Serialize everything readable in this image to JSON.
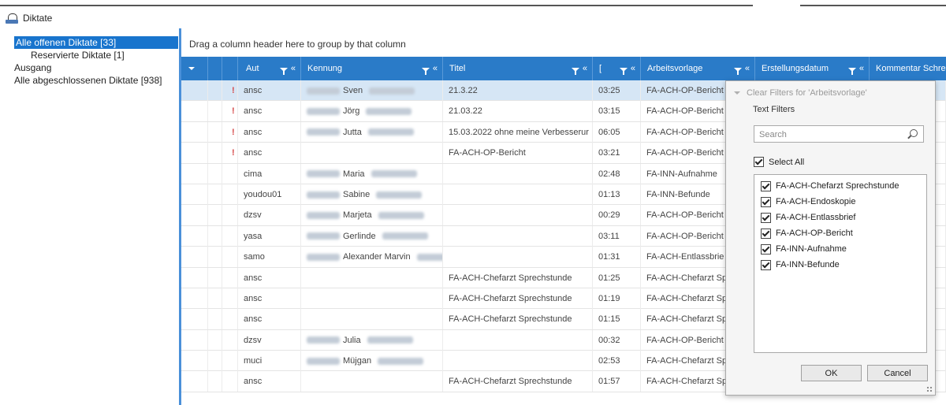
{
  "app": {
    "title": "Diktate"
  },
  "tree": {
    "items": [
      {
        "label": "Alle offenen Diktate  [33]",
        "selected": true,
        "indent": false
      },
      {
        "label": "Reservierte Diktate  [1]",
        "selected": false,
        "indent": true
      },
      {
        "label": "Ausgang",
        "selected": false,
        "indent": false
      },
      {
        "label": "Alle abgeschlossenen Diktate  [938]",
        "selected": false,
        "indent": false
      }
    ]
  },
  "grid": {
    "group_hint": "Drag a column header here to group by that column",
    "columns": {
      "aut": "Aut",
      "kennung": "Kennung",
      "titel": "Titel",
      "dauer": "[",
      "vorlage": "Arbeitsvorlage",
      "datum": "Erstellungsdatum",
      "kommentar": "Kommentar Schre"
    },
    "rows": [
      {
        "flag": "!",
        "aut": "ansc",
        "name": "Sven",
        "titel": "21.3.22",
        "dauer": "03:25",
        "vorlage": "FA-ACH-OP-Bericht",
        "selected": true
      },
      {
        "flag": "!",
        "aut": "ansc",
        "name": "Jörg",
        "titel": "21.03.22",
        "dauer": "03:15",
        "vorlage": "FA-ACH-OP-Bericht"
      },
      {
        "flag": "!",
        "aut": "ansc",
        "name": "Jutta",
        "titel": "15.03.2022 ohne meine Verbesserur",
        "dauer": "06:05",
        "vorlage": "FA-ACH-OP-Bericht"
      },
      {
        "flag": "!",
        "aut": "ansc",
        "name": "",
        "titel": "FA-ACH-OP-Bericht",
        "dauer": "03:21",
        "vorlage": "FA-ACH-OP-Bericht"
      },
      {
        "flag": "",
        "aut": "cima",
        "name": "Maria",
        "titel": "",
        "dauer": "02:48",
        "vorlage": "FA-INN-Aufnahme"
      },
      {
        "flag": "",
        "aut": "youdou01",
        "name": "Sabine",
        "titel": "",
        "dauer": "01:13",
        "vorlage": "FA-INN-Befunde"
      },
      {
        "flag": "",
        "aut": "dzsv",
        "name": "Marjeta",
        "titel": "",
        "dauer": "00:29",
        "vorlage": "FA-ACH-OP-Bericht"
      },
      {
        "flag": "",
        "aut": "yasa",
        "name": "Gerlinde",
        "titel": "",
        "dauer": "03:11",
        "vorlage": "FA-ACH-OP-Bericht"
      },
      {
        "flag": "",
        "aut": "samo",
        "name": "Alexander Marvin",
        "titel": "",
        "dauer": "01:31",
        "vorlage": "FA-ACH-Entlassbrie"
      },
      {
        "flag": "",
        "aut": "ansc",
        "name": "",
        "titel": "FA-ACH-Chefarzt Sprechstunde",
        "dauer": "01:25",
        "vorlage": "FA-ACH-Chefarzt Sp"
      },
      {
        "flag": "",
        "aut": "ansc",
        "name": "",
        "titel": "FA-ACH-Chefarzt Sprechstunde",
        "dauer": "01:19",
        "vorlage": "FA-ACH-Chefarzt Sp"
      },
      {
        "flag": "",
        "aut": "ansc",
        "name": "",
        "titel": "FA-ACH-Chefarzt Sprechstunde",
        "dauer": "01:15",
        "vorlage": "FA-ACH-Chefarzt Sp"
      },
      {
        "flag": "",
        "aut": "dzsv",
        "name": "Julia",
        "titel": "",
        "dauer": "00:32",
        "vorlage": "FA-ACH-OP-Bericht"
      },
      {
        "flag": "",
        "aut": "muci",
        "name": "Müjgan",
        "titel": "",
        "dauer": "02:53",
        "vorlage": "FA-ACH-Chefarzt Sp"
      },
      {
        "flag": "",
        "aut": "ansc",
        "name": "",
        "titel": "FA-ACH-Chefarzt Sprechstunde",
        "dauer": "01:57",
        "vorlage": "FA-ACH-Chefarzt Sp"
      }
    ]
  },
  "filter_popup": {
    "clear_label": "Clear Filters for 'Arbeitsvorlage'",
    "text_filters_label": "Text Filters",
    "search_placeholder": "Search",
    "select_all_label": "Select All",
    "values": [
      {
        "label": "FA-ACH-Chefarzt Sprechstunde",
        "checked": true
      },
      {
        "label": "FA-ACH-Endoskopie",
        "checked": true
      },
      {
        "label": "FA-ACH-Entlassbrief",
        "checked": true
      },
      {
        "label": "FA-ACH-OP-Bericht",
        "checked": true
      },
      {
        "label": "FA-INN-Aufnahme",
        "checked": true
      },
      {
        "label": "FA-INN-Befunde",
        "checked": true
      }
    ],
    "ok_label": "OK",
    "cancel_label": "Cancel"
  }
}
